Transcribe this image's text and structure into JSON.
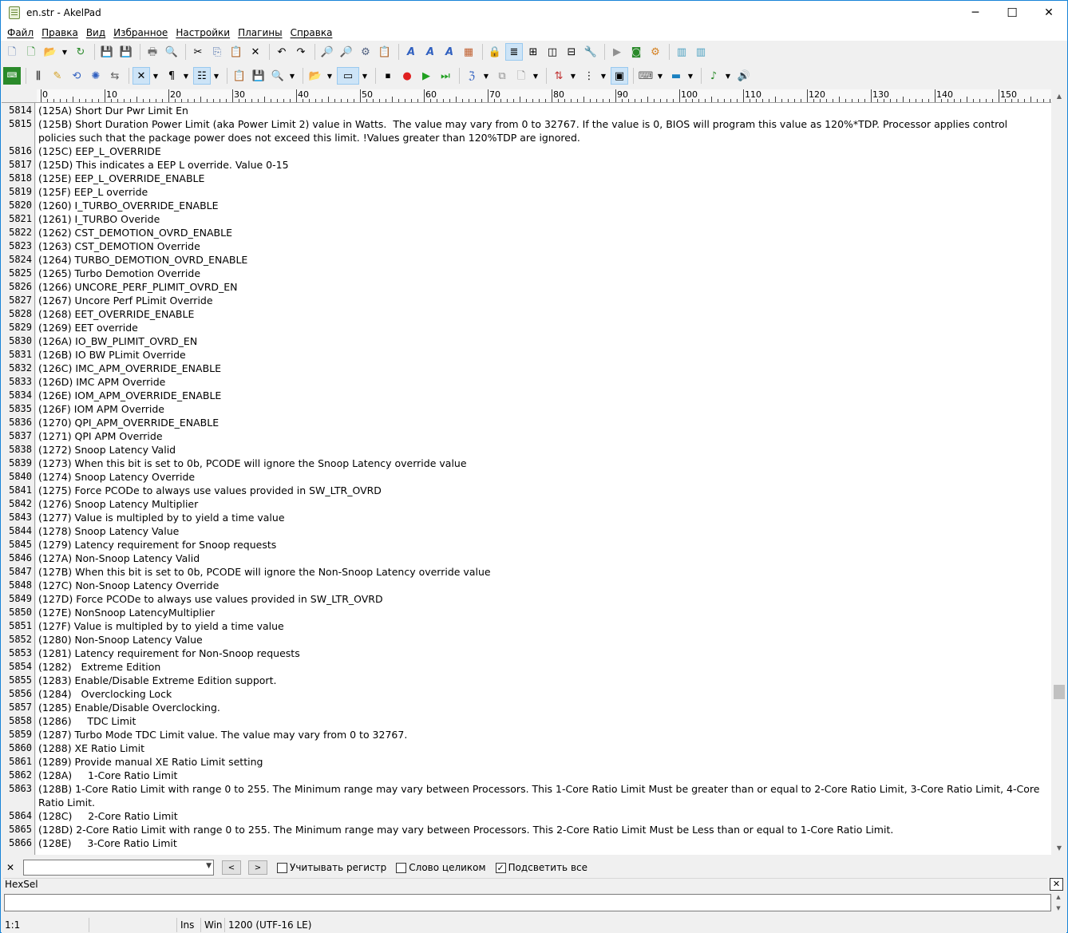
{
  "window": {
    "title": "en.str - AkelPad",
    "minimize": "─",
    "maximize": "☐",
    "close": "✕"
  },
  "menu": [
    "Файл",
    "Правка",
    "Вид",
    "Избранное",
    "Настройки",
    "Плагины",
    "Справка"
  ],
  "ruler": {
    "labels": [
      "0",
      "10",
      "20",
      "30",
      "40",
      "50",
      "60",
      "70",
      "80",
      "90",
      "100",
      "110",
      "120",
      "130",
      "140",
      "150"
    ]
  },
  "lines": [
    {
      "n": "5814",
      "t": "(125A) Short Dur Pwr Limit En",
      "rows": 1
    },
    {
      "n": "5815",
      "t": "(125B) Short Duration Power Limit (aka Power Limit 2) value in Watts.  The value may vary from 0 to 32767. If the value is 0, BIOS will program this value as 120%*TDP. Processor applies control policies such that the package power does not exceed this limit. !Values greater than 120%TDP are ignored.",
      "rows": 2
    },
    {
      "n": "5816",
      "t": "(125C) EEP_L_OVERRIDE",
      "rows": 1
    },
    {
      "n": "5817",
      "t": "(125D) This indicates a EEP L override. Value 0-15",
      "rows": 1
    },
    {
      "n": "5818",
      "t": "(125E) EEP_L_OVERRIDE_ENABLE",
      "rows": 1
    },
    {
      "n": "5819",
      "t": "(125F) EEP_L override",
      "rows": 1
    },
    {
      "n": "5820",
      "t": "(1260) I_TURBO_OVERRIDE_ENABLE",
      "rows": 1
    },
    {
      "n": "5821",
      "t": "(1261) I_TURBO Overide",
      "rows": 1
    },
    {
      "n": "5822",
      "t": "(1262) CST_DEMOTION_OVRD_ENABLE",
      "rows": 1
    },
    {
      "n": "5823",
      "t": "(1263) CST_DEMOTION Override",
      "rows": 1
    },
    {
      "n": "5824",
      "t": "(1264) TURBO_DEMOTION_OVRD_ENABLE",
      "rows": 1
    },
    {
      "n": "5825",
      "t": "(1265) Turbo Demotion Override",
      "rows": 1
    },
    {
      "n": "5826",
      "t": "(1266) UNCORE_PERF_PLIMIT_OVRD_EN",
      "rows": 1
    },
    {
      "n": "5827",
      "t": "(1267) Uncore Perf PLimit Override",
      "rows": 1
    },
    {
      "n": "5828",
      "t": "(1268) EET_OVERRIDE_ENABLE",
      "rows": 1
    },
    {
      "n": "5829",
      "t": "(1269) EET override",
      "rows": 1
    },
    {
      "n": "5830",
      "t": "(126A) IO_BW_PLIMIT_OVRD_EN",
      "rows": 1
    },
    {
      "n": "5831",
      "t": "(126B) IO BW PLimit Override",
      "rows": 1
    },
    {
      "n": "5832",
      "t": "(126C) IMC_APM_OVERRIDE_ENABLE",
      "rows": 1
    },
    {
      "n": "5833",
      "t": "(126D) IMC APM Override",
      "rows": 1
    },
    {
      "n": "5834",
      "t": "(126E) IOM_APM_OVERRIDE_ENABLE",
      "rows": 1
    },
    {
      "n": "5835",
      "t": "(126F) IOM APM Override",
      "rows": 1
    },
    {
      "n": "5836",
      "t": "(1270) QPI_APM_OVERRIDE_ENABLE",
      "rows": 1
    },
    {
      "n": "5837",
      "t": "(1271) QPI APM Override",
      "rows": 1
    },
    {
      "n": "5838",
      "t": "(1272) Snoop Latency Valid",
      "rows": 1
    },
    {
      "n": "5839",
      "t": "(1273) When this bit is set to 0b, PCODE will ignore the Snoop Latency override value",
      "rows": 1
    },
    {
      "n": "5840",
      "t": "(1274) Snoop Latency Override",
      "rows": 1
    },
    {
      "n": "5841",
      "t": "(1275) Force PCODe to always use values provided in SW_LTR_OVRD",
      "rows": 1
    },
    {
      "n": "5842",
      "t": "(1276) Snoop Latency Multiplier",
      "rows": 1
    },
    {
      "n": "5843",
      "t": "(1277) Value is multipled by to yield a time value",
      "rows": 1
    },
    {
      "n": "5844",
      "t": "(1278) Snoop Latency Value",
      "rows": 1
    },
    {
      "n": "5845",
      "t": "(1279) Latency requirement for Snoop requests",
      "rows": 1
    },
    {
      "n": "5846",
      "t": "(127A) Non-Snoop Latency Valid",
      "rows": 1
    },
    {
      "n": "5847",
      "t": "(127B) When this bit is set to 0b, PCODE will ignore the Non-Snoop Latency override value",
      "rows": 1
    },
    {
      "n": "5848",
      "t": "(127C) Non-Snoop Latency Override",
      "rows": 1
    },
    {
      "n": "5849",
      "t": "(127D) Force PCODe to always use values provided in SW_LTR_OVRD",
      "rows": 1
    },
    {
      "n": "5850",
      "t": "(127E) NonSnoop LatencyMultiplier",
      "rows": 1
    },
    {
      "n": "5851",
      "t": "(127F) Value is multipled by to yield a time value",
      "rows": 1
    },
    {
      "n": "5852",
      "t": "(1280) Non-Snoop Latency Value",
      "rows": 1
    },
    {
      "n": "5853",
      "t": "(1281) Latency requirement for Non-Snoop requests",
      "rows": 1
    },
    {
      "n": "5854",
      "t": "(1282)   Extreme Edition",
      "rows": 1
    },
    {
      "n": "5855",
      "t": "(1283) Enable/Disable Extreme Edition support.",
      "rows": 1
    },
    {
      "n": "5856",
      "t": "(1284)   Overclocking Lock",
      "rows": 1
    },
    {
      "n": "5857",
      "t": "(1285) Enable/Disable Overclocking.",
      "rows": 1
    },
    {
      "n": "5858",
      "t": "(1286)     TDC Limit",
      "rows": 1
    },
    {
      "n": "5859",
      "t": "(1287) Turbo Mode TDC Limit value. The value may vary from 0 to 32767.",
      "rows": 1
    },
    {
      "n": "5860",
      "t": "(1288) XE Ratio Limit",
      "rows": 1
    },
    {
      "n": "5861",
      "t": "(1289) Provide manual XE Ratio Limit setting",
      "rows": 1
    },
    {
      "n": "5862",
      "t": "(128A)     1-Core Ratio Limit",
      "rows": 1
    },
    {
      "n": "5863",
      "t": "(128B) 1-Core Ratio Limit with range 0 to 255. The Minimum range may vary between Processors. This 1-Core Ratio Limit Must be greater than or equal to 2-Core Ratio Limit, 3-Core Ratio Limit, 4-Core Ratio Limit.",
      "rows": 2
    },
    {
      "n": "5864",
      "t": "(128C)     2-Core Ratio Limit",
      "rows": 1
    },
    {
      "n": "5865",
      "t": "(128D) 2-Core Ratio Limit with range 0 to 255. The Minimum range may vary between Processors. This 2-Core Ratio Limit Must be Less than or equal to 1-Core Ratio Limit.",
      "rows": 1
    },
    {
      "n": "5866",
      "t": "(128E)     3-Core Ratio Limit",
      "rows": 1
    }
  ],
  "findbar": {
    "close": "✕",
    "prev": "<",
    "next": ">",
    "match_case": "Учитывать регистр",
    "whole_word": "Слово целиком",
    "highlight_all": "Подсветить все",
    "match_case_checked": false,
    "whole_word_checked": false,
    "highlight_all_checked": true
  },
  "hexsel": {
    "label": "HexSel",
    "close": "✕"
  },
  "status": {
    "pos": "1:1",
    "mode": "Ins",
    "eol": "Win",
    "encoding": "1200  (UTF-16 LE)"
  }
}
